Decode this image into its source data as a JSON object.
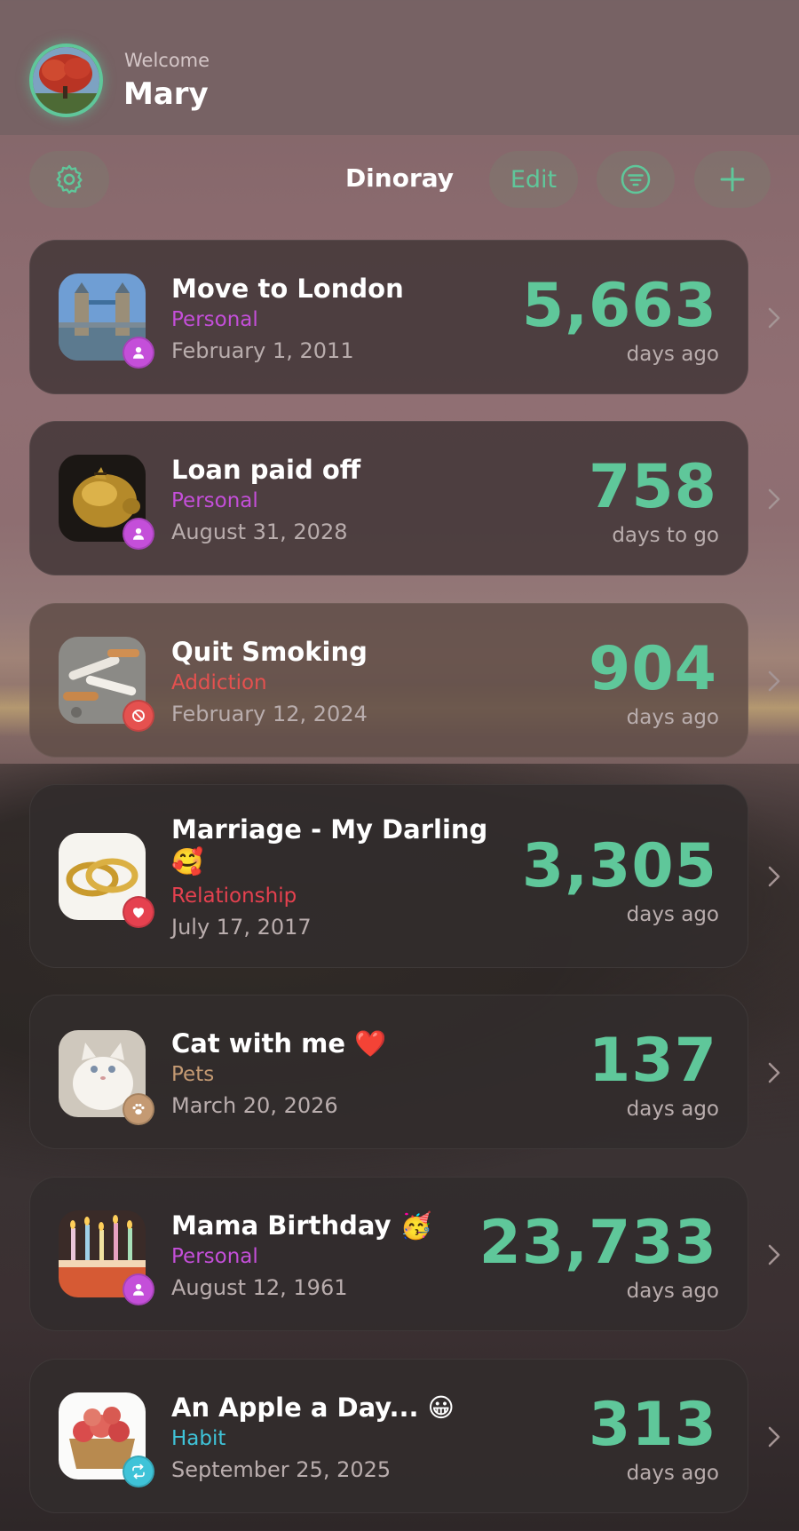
{
  "header": {
    "welcome": "Welcome",
    "user_name": "Mary"
  },
  "toolbar": {
    "title": "Dinoray",
    "edit_label": "Edit",
    "icons": [
      "gear-icon",
      "filter-icon",
      "plus-icon"
    ]
  },
  "colors": {
    "accent": "#5fc79a",
    "personal": "#c44fd9",
    "addiction": "#e5514f",
    "relationship": "#e5414f",
    "pets": "#c49a73",
    "habit": "#3fc3d8"
  },
  "events": [
    {
      "title": "Move to London",
      "category": "Personal",
      "date": "February 1, 2011",
      "count": "5,663",
      "unit": "days ago",
      "badge_icon": "person-icon"
    },
    {
      "title": "Loan paid off",
      "category": "Personal",
      "date": "August 31, 2028",
      "count": "758",
      "unit": "days to go",
      "badge_icon": "person-icon"
    },
    {
      "title": "Quit Smoking",
      "category": "Addiction",
      "date": "February 12, 2024",
      "count": "904",
      "unit": "days ago",
      "badge_icon": "no-sign-icon"
    },
    {
      "title": "Marriage - My Darling",
      "title_line2": "🥰",
      "category": "Relationship",
      "date": "July 17, 2017",
      "count": "3,305",
      "unit": "days ago",
      "badge_icon": "heart-icon"
    },
    {
      "title": "Cat with me ❤️",
      "category": "Pets",
      "date": "March 20, 2026",
      "count": "137",
      "unit": "days ago",
      "badge_icon": "paw-icon"
    },
    {
      "title": "Mama Birthday 🥳",
      "category": "Personal",
      "date": "August 12, 1961",
      "count": "23,733",
      "unit": "days ago",
      "badge_icon": "person-icon"
    },
    {
      "title": "An Apple a Day... 😀",
      "category": "Habit",
      "date": "September 25, 2025",
      "count": "313",
      "unit": "days ago",
      "badge_icon": "repeat-icon"
    }
  ]
}
